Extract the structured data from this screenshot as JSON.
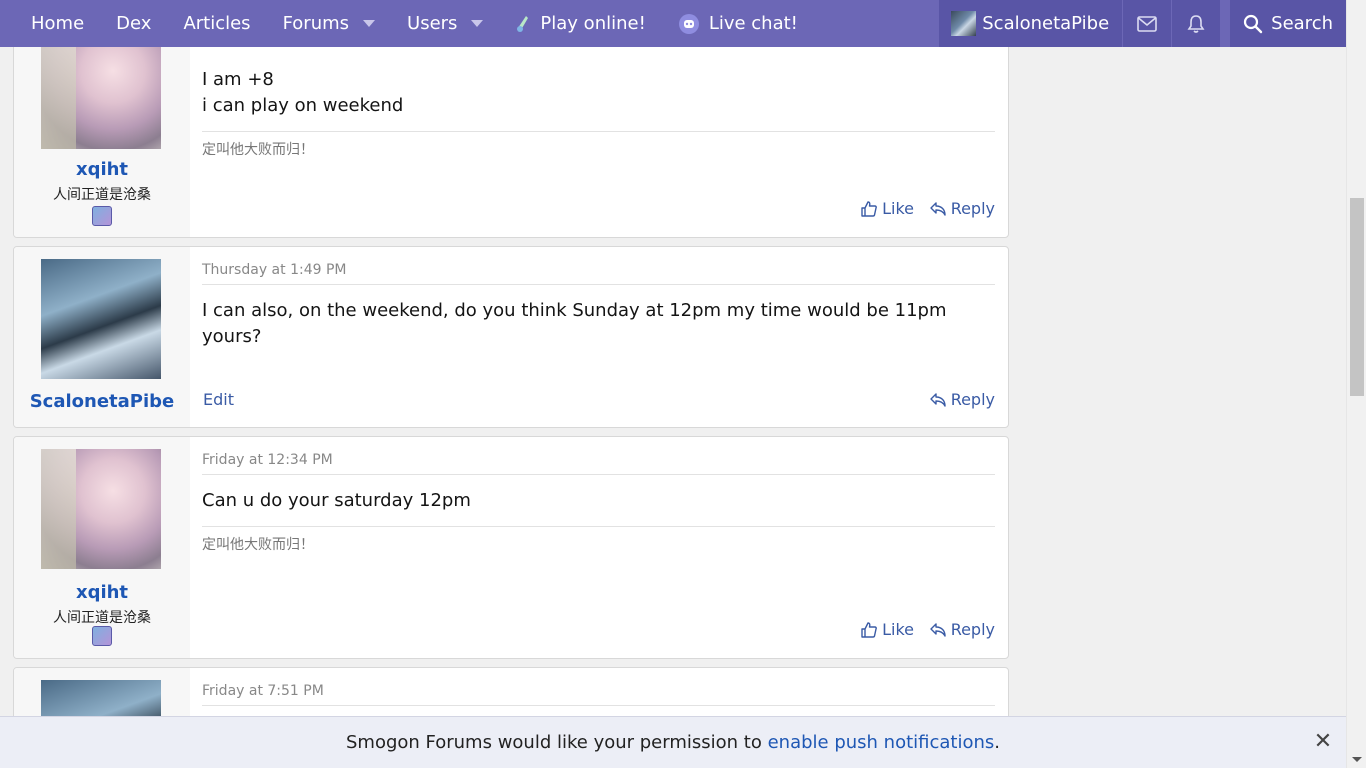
{
  "nav": {
    "home": "Home",
    "dex": "Dex",
    "articles": "Articles",
    "forums": "Forums",
    "users": "Users",
    "play_online": "Play online!",
    "live_chat": "Live chat!",
    "username": "ScalonetaPibe",
    "search": "Search"
  },
  "colors": {
    "nav_bg": "#6c67b6",
    "nav_right_bg": "#5955a6",
    "link": "#1e57b4",
    "action": "#3a5ba5"
  },
  "messages": [
    {
      "username": "xqiht",
      "user_title": "人间正道是沧桑",
      "lines": [
        "I am +8",
        "i can play on weekend"
      ],
      "signature": "定叫他大败而归！",
      "like_label": "Like",
      "reply_label": "Reply"
    },
    {
      "username": "ScalonetaPibe",
      "date": "Thursday at 1:49 PM",
      "text": "I can also, on the weekend, do you think Sunday at 12pm my time would be 11pm yours?",
      "edit_label": "Edit",
      "reply_label": "Reply"
    },
    {
      "username": "xqiht",
      "user_title": "人间正道是沧桑",
      "date": "Friday at 12:34 PM",
      "text": "Can u do your saturday 12pm",
      "signature": "定叫他大败而归！",
      "like_label": "Like",
      "reply_label": "Reply"
    },
    {
      "date": "Friday at 7:51 PM"
    }
  ],
  "push": {
    "prefix": "Smogon Forums would like your permission to ",
    "link": "enable push notifications",
    "suffix": "."
  }
}
